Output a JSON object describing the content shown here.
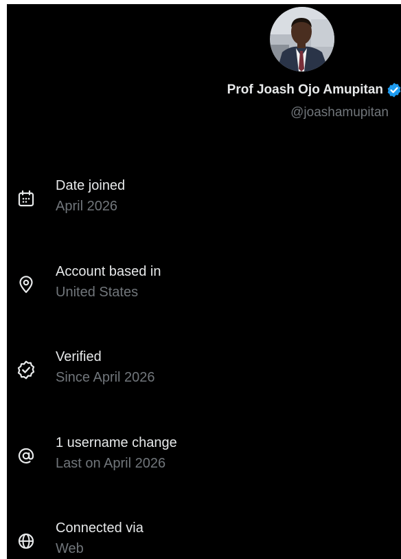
{
  "profile": {
    "display_name": "Prof Joash Ojo Amupitan",
    "handle": "@joashamupitan",
    "verified_color": "#1d9bf0"
  },
  "details": [
    {
      "icon": "calendar-icon",
      "label": "Date joined",
      "value": "April 2026"
    },
    {
      "icon": "location-pin-icon",
      "label": "Account based in",
      "value": "United States"
    },
    {
      "icon": "verified-check-icon",
      "label": "Verified",
      "value": "Since April 2026"
    },
    {
      "icon": "at-sign-icon",
      "label": "1 username change",
      "value": "Last on April 2026"
    },
    {
      "icon": "globe-icon",
      "label": "Connected via",
      "value": "Web"
    }
  ],
  "colors": {
    "background": "#000000",
    "primary_text": "#e7e9ea",
    "secondary_text": "#71767b"
  }
}
